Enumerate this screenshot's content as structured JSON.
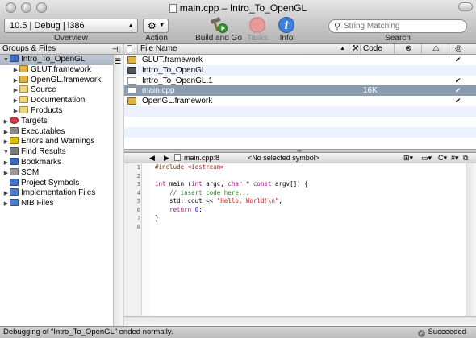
{
  "window": {
    "title": "main.cpp – Intro_To_OpenGL"
  },
  "toolbar": {
    "overview_value": "10.5 | Debug | i386",
    "overview_label": "Overview",
    "action_label": "Action",
    "build_go_label": "Build and Go",
    "tasks_label": "Tasks",
    "info_label": "Info",
    "search_placeholder": "String Matching",
    "search_label": "Search"
  },
  "sidebar": {
    "header": "Groups & Files",
    "items": [
      {
        "label": "Intro_To_OpenGL",
        "icon": "project-icon",
        "color": "#3b6fc4",
        "tri": "▼",
        "indent": 0,
        "selected": true
      },
      {
        "label": "GLUT.framework",
        "icon": "framework-icon",
        "color": "#e3b23c",
        "tri": "▶",
        "indent": 1
      },
      {
        "label": "OpenGL.framework",
        "icon": "framework-icon",
        "color": "#e3b23c",
        "tri": "▶",
        "indent": 1
      },
      {
        "label": "Source",
        "icon": "folder-icon",
        "color": "#f1d77a",
        "tri": "▶",
        "indent": 1
      },
      {
        "label": "Documentation",
        "icon": "folder-icon",
        "color": "#f1d77a",
        "tri": "▶",
        "indent": 1
      },
      {
        "label": "Products",
        "icon": "folder-icon",
        "color": "#f1d77a",
        "tri": "▶",
        "indent": 1
      },
      {
        "label": "Targets",
        "icon": "target-icon",
        "color": "#d23b3b",
        "tri": "▶",
        "indent": 0
      },
      {
        "label": "Executables",
        "icon": "executable-icon",
        "color": "#8a8a8a",
        "tri": "▶",
        "indent": 0
      },
      {
        "label": "Errors and Warnings",
        "icon": "warning-icon",
        "color": "#e2c000",
        "tri": "▶",
        "indent": 0
      },
      {
        "label": "Find Results",
        "icon": "magnifier-icon",
        "color": "#7c7c7c",
        "tri": "▼",
        "indent": 0
      },
      {
        "label": "Bookmarks",
        "icon": "bookmark-icon",
        "color": "#3a6cc0",
        "tri": "▶",
        "indent": 0
      },
      {
        "label": "SCM",
        "icon": "scm-icon",
        "color": "#9a9a9a",
        "tri": "▶",
        "indent": 0
      },
      {
        "label": "Project Symbols",
        "icon": "symbols-icon",
        "color": "#3f72d0",
        "tri": "",
        "indent": 0
      },
      {
        "label": "Implementation Files",
        "icon": "smart-group-icon",
        "color": "#4d7fcf",
        "tri": "▶",
        "indent": 0
      },
      {
        "label": "NIB Files",
        "icon": "smart-group-icon",
        "color": "#4d7fcf",
        "tri": "▶",
        "indent": 0
      }
    ]
  },
  "detail": {
    "col_file_name": "File Name",
    "col_code": "Code",
    "rows": [
      {
        "name": "GLUT.framework",
        "code": "",
        "checked": true,
        "icon": "framework-icon",
        "color": "#e3b23c",
        "alt": false,
        "selected": false
      },
      {
        "name": "Intro_To_OpenGL",
        "code": "",
        "checked": false,
        "icon": "executable-icon",
        "color": "#555555",
        "alt": true,
        "selected": false
      },
      {
        "name": "Intro_To_OpenGL.1",
        "code": "",
        "checked": true,
        "icon": "document-icon",
        "color": "#ffffff",
        "alt": false,
        "selected": false
      },
      {
        "name": "main.cpp",
        "code": "16K",
        "checked": true,
        "icon": "cpp-file-icon",
        "color": "#ffffff",
        "alt": false,
        "selected": true
      },
      {
        "name": "OpenGL.framework",
        "code": "",
        "checked": true,
        "icon": "framework-icon",
        "color": "#e3b23c",
        "alt": false,
        "selected": false
      }
    ]
  },
  "navbar": {
    "file": "main.cpp:8",
    "symbol": "<No selected symbol>"
  },
  "editor": {
    "line_numbers": [
      "1",
      "2",
      "3",
      "4",
      "5",
      "6",
      "7",
      "8"
    ]
  },
  "status": {
    "message": "Debugging of “Intro_To_OpenGL” ended normally.",
    "result": "Succeeded"
  }
}
